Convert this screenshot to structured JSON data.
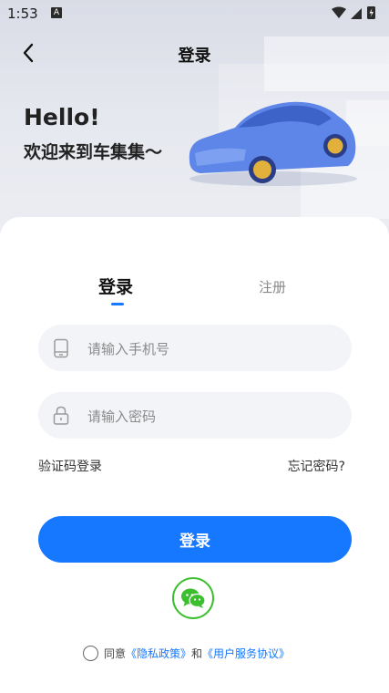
{
  "status_bar": {
    "time": "1:53",
    "a_badge": "A"
  },
  "nav": {
    "title": "登录"
  },
  "hero": {
    "hello": "Hello!",
    "welcome": "欢迎来到车集集～"
  },
  "tabs": {
    "login": "登录",
    "register": "注册"
  },
  "form": {
    "phone_placeholder": "请输入手机号",
    "password_placeholder": "请输入密码",
    "sms_login": "验证码登录",
    "forgot_password": "忘记密码?"
  },
  "login_button": "登录",
  "agreement": {
    "agree": "同意",
    "privacy": "《隐私政策》",
    "and": "和",
    "terms": "《用户服务协议》"
  },
  "colors": {
    "accent": "#1677ff",
    "wechat": "#3cbf2e"
  }
}
